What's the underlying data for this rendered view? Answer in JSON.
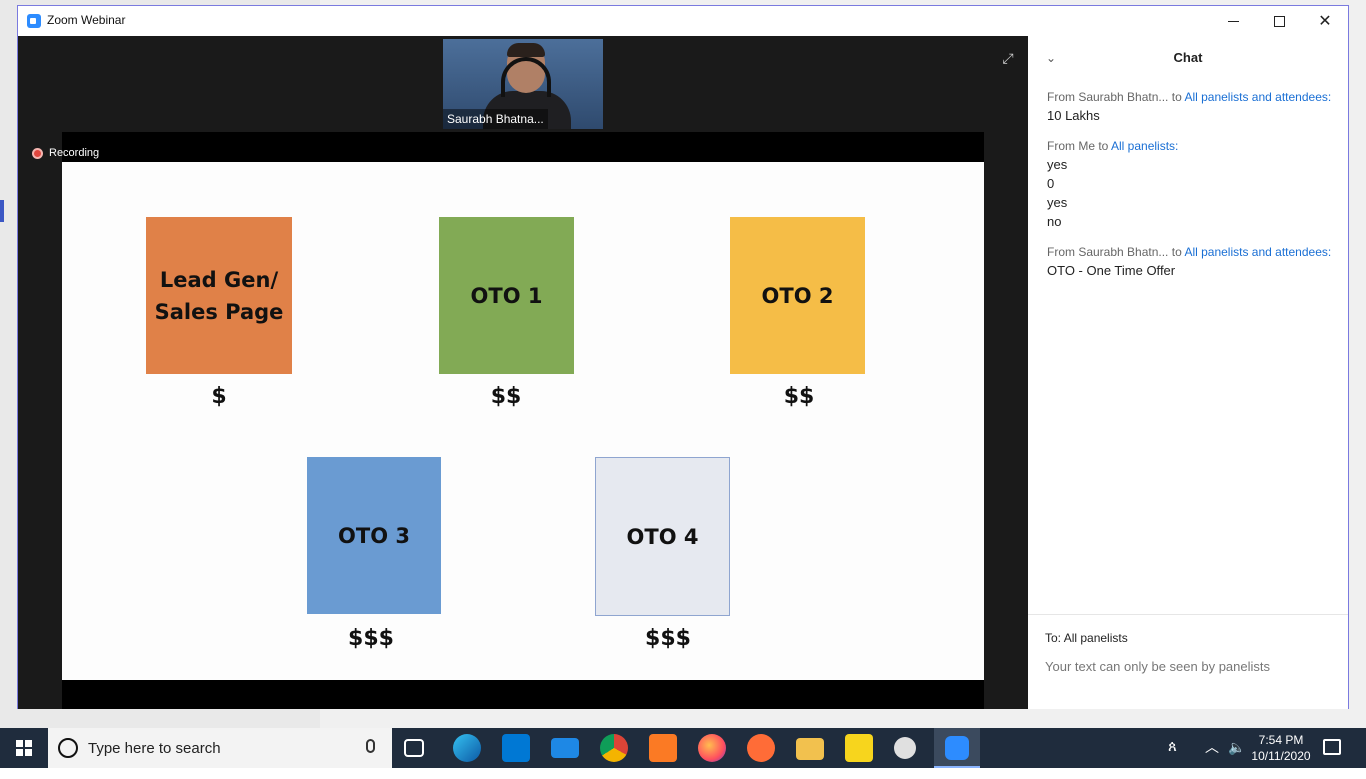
{
  "window": {
    "title": "Zoom Webinar"
  },
  "stage": {
    "speaker_name": "Saurabh Bhatna...",
    "recording_label": "Recording"
  },
  "slide": {
    "boxes": [
      {
        "label": "Lead Gen/ Sales Page",
        "price": "$"
      },
      {
        "label": "OTO 1",
        "price": "$$"
      },
      {
        "label": "OTO 2",
        "price": "$$"
      },
      {
        "label": "OTO 3",
        "price": "$$$"
      },
      {
        "label": "OTO 4",
        "price": "$$$"
      }
    ]
  },
  "chat": {
    "title": "Chat",
    "messages": [
      {
        "from": "From Saurabh Bhatn...",
        "to": "to",
        "target": "All panelists and attendees:",
        "lines": [
          "10 Lakhs"
        ]
      },
      {
        "from": "From Me to",
        "to": "",
        "target": "All panelists:",
        "lines": [
          "yes",
          "0",
          "yes",
          "no"
        ]
      },
      {
        "from": "From Saurabh Bhatn...",
        "to": "to",
        "target": "All panelists and attendees:",
        "lines": [
          "OTO - One Time Offer"
        ]
      }
    ],
    "to_label": "To:",
    "to_value": "All panelists",
    "input_hint": "Your text can only be seen by panelists"
  },
  "taskbar": {
    "search_placeholder": "Type here to search",
    "time": "7:54 PM",
    "date": "10/11/2020"
  }
}
